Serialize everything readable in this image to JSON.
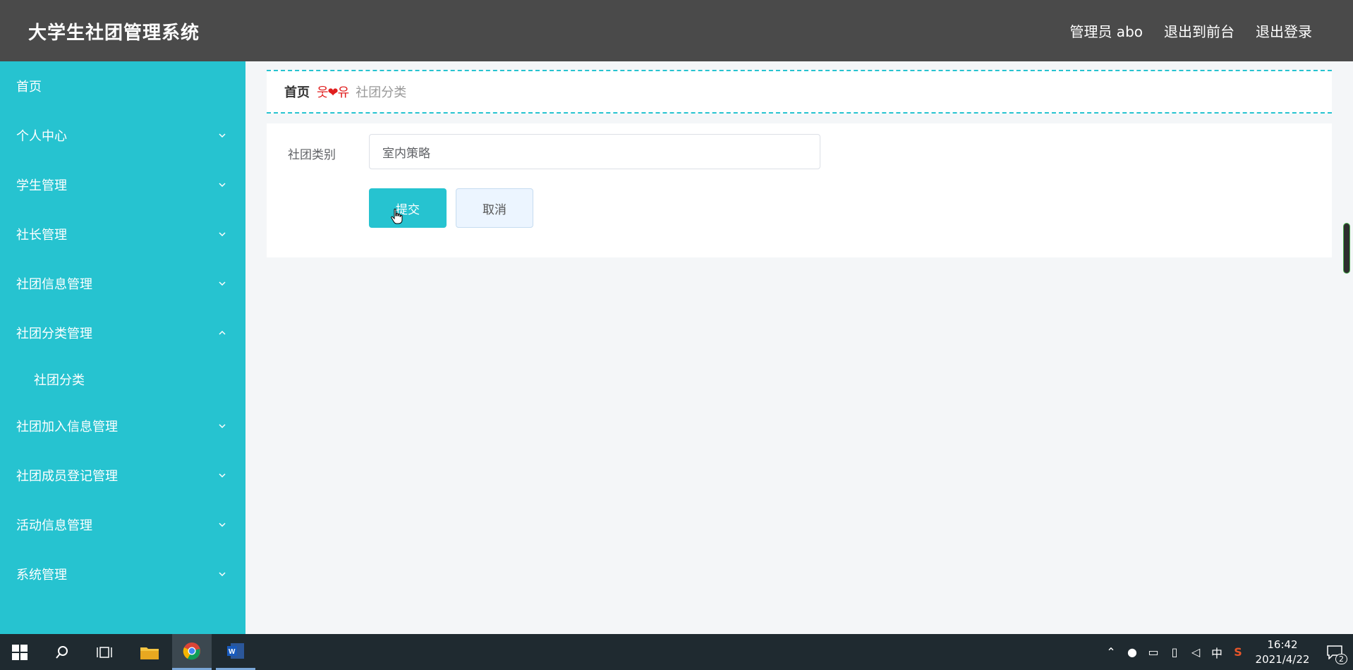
{
  "header": {
    "title": "大学生社团管理系统",
    "admin_label": "管理员 abo",
    "exit_front_label": "退出到前台",
    "logout_label": "退出登录"
  },
  "sidebar": {
    "items": [
      {
        "label": "首页",
        "expandable": false
      },
      {
        "label": "个人中心",
        "expandable": true,
        "expanded": false
      },
      {
        "label": "学生管理",
        "expandable": true,
        "expanded": false
      },
      {
        "label": "社长管理",
        "expandable": true,
        "expanded": false
      },
      {
        "label": "社团信息管理",
        "expandable": true,
        "expanded": false
      },
      {
        "label": "社团分类管理",
        "expandable": true,
        "expanded": true
      },
      {
        "label": "社团分类",
        "sub": true
      },
      {
        "label": "社团加入信息管理",
        "expandable": true,
        "expanded": false
      },
      {
        "label": "社团成员登记管理",
        "expandable": true,
        "expanded": false
      },
      {
        "label": "活动信息管理",
        "expandable": true,
        "expanded": false
      },
      {
        "label": "系统管理",
        "expandable": true,
        "expanded": false
      }
    ]
  },
  "breadcrumb": {
    "home": "首页",
    "separator": "웃❤유",
    "current": "社团分类"
  },
  "form": {
    "category_label": "社团类别",
    "category_value": "室内策略",
    "submit_label": "提交",
    "cancel_label": "取消"
  },
  "taskbar": {
    "ime_label": "中",
    "time": "16:42",
    "date": "2021/4/22",
    "notification_count": "2"
  },
  "colors": {
    "accent": "#26c3d0",
    "header_bg": "#4a4a4a",
    "taskbar_bg": "#1f2a30"
  }
}
